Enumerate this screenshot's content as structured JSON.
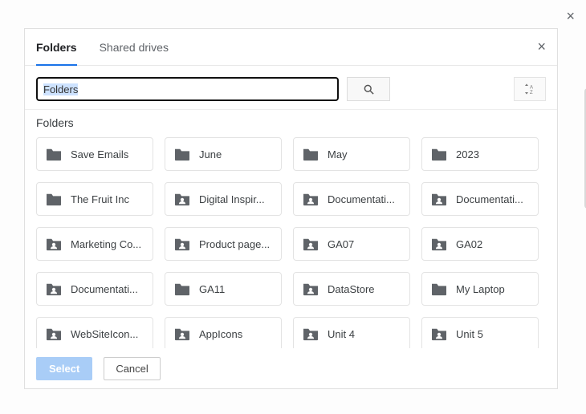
{
  "outer": {
    "close_label": "×"
  },
  "tabs": [
    {
      "label": "Folders",
      "active": true
    },
    {
      "label": "Shared drives",
      "active": false
    }
  ],
  "inner_close": "×",
  "search": {
    "value": "Folders"
  },
  "section_title": "Folders",
  "folders": [
    {
      "name": "Save Emails",
      "shared": false
    },
    {
      "name": "June",
      "shared": false
    },
    {
      "name": "May",
      "shared": false
    },
    {
      "name": "2023",
      "shared": false
    },
    {
      "name": "The Fruit Inc",
      "shared": false
    },
    {
      "name": "Digital Inspir...",
      "shared": true
    },
    {
      "name": "Documentati...",
      "shared": true
    },
    {
      "name": "Documentati...",
      "shared": true
    },
    {
      "name": "Marketing Co...",
      "shared": true
    },
    {
      "name": "Product page...",
      "shared": true
    },
    {
      "name": "GA07",
      "shared": true
    },
    {
      "name": "GA02",
      "shared": true
    },
    {
      "name": "Documentati...",
      "shared": true
    },
    {
      "name": "GA11",
      "shared": false
    },
    {
      "name": "DataStore",
      "shared": true
    },
    {
      "name": "My Laptop",
      "shared": false
    },
    {
      "name": "WebSiteIcon...",
      "shared": true
    },
    {
      "name": "AppIcons",
      "shared": true
    },
    {
      "name": "Unit 4",
      "shared": true
    },
    {
      "name": "Unit 5",
      "shared": true
    }
  ],
  "footer": {
    "select": "Select",
    "cancel": "Cancel"
  },
  "icons": {
    "search": "search-icon",
    "sort": "sort-az-icon",
    "folder": "folder-icon",
    "folder_shared": "shared-folder-icon"
  }
}
